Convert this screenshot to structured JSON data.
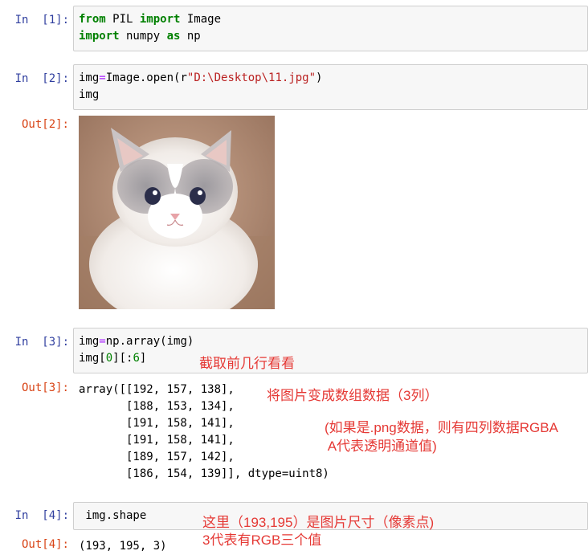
{
  "cells": [
    {
      "prompt": "In  [1]:",
      "code_lines": [
        [
          {
            "t": "from",
            "c": "kw"
          },
          {
            "t": " PIL ",
            "c": ""
          },
          {
            "t": "import",
            "c": "kw"
          },
          {
            "t": " Image",
            "c": ""
          }
        ],
        [
          {
            "t": "import",
            "c": "kw"
          },
          {
            "t": " numpy ",
            "c": ""
          },
          {
            "t": "as",
            "c": "kw"
          },
          {
            "t": " np",
            "c": ""
          }
        ]
      ]
    },
    {
      "prompt": "In  [2]:",
      "code_lines": [
        [
          {
            "t": "img",
            "c": ""
          },
          {
            "t": "=",
            "c": "op"
          },
          {
            "t": "Image.open(r",
            "c": ""
          },
          {
            "t": "\"D:\\Desktop\\11.jpg\"",
            "c": "str"
          },
          {
            "t": ")",
            "c": ""
          }
        ],
        [
          {
            "t": "img",
            "c": ""
          }
        ]
      ],
      "out_prompt": "Out[2]:",
      "image_alt": "fluffy white and grey ragdoll kitten"
    },
    {
      "prompt": "In  [3]:",
      "code_lines": [
        [
          {
            "t": "img",
            "c": ""
          },
          {
            "t": "=",
            "c": "op"
          },
          {
            "t": "np.array(img)",
            "c": ""
          }
        ],
        [
          {
            "t": "img[",
            "c": ""
          },
          {
            "t": "0",
            "c": "num"
          },
          {
            "t": "][:",
            "c": ""
          },
          {
            "t": "6",
            "c": "num"
          },
          {
            "t": "]",
            "c": ""
          }
        ]
      ],
      "out_prompt": "Out[3]:",
      "output_lines": [
        "array([[192, 157, 138],",
        "       [188, 153, 134],",
        "       [191, 158, 141],",
        "       [191, 158, 141],",
        "       [189, 157, 142],",
        "       [186, 154, 139]], dtype=uint8)"
      ]
    },
    {
      "prompt": "In  [4]:",
      "code_lines": [
        [
          {
            "t": " img.shape",
            "c": ""
          }
        ]
      ],
      "out_prompt": "Out[4]:",
      "output_lines": [
        "(193, 195, 3)"
      ]
    }
  ],
  "annotations": {
    "slice_note": "截取前几行看看",
    "array_note": "将图片变成数组数据（3列）",
    "png_note_line1": "(如果是.png数据，则有四列数据RGBA",
    "png_note_line2": " A代表透明通道值)",
    "shape_note_line1": "这里（193,195）是图片尺寸（像素点)",
    "shape_note_line2": "3代表有RGB三个值"
  },
  "colors": {
    "in_prompt": "#303f9f",
    "out_prompt": "#d84315",
    "keyword": "#008000",
    "string": "#ba2121",
    "operator": "#aa22ff",
    "annotation": "#e53935"
  }
}
